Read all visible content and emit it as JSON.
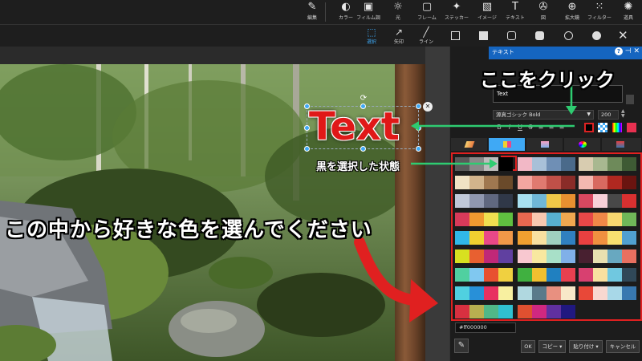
{
  "toolbar": {
    "items": [
      {
        "label": "編集",
        "icon": "edit-icon",
        "glyph": "✎"
      },
      {
        "label": "カラー",
        "icon": "color-icon",
        "glyph": "◐"
      },
      {
        "label": "フィルム調",
        "icon": "film-icon",
        "glyph": "▣"
      },
      {
        "label": "光",
        "icon": "light-icon",
        "glyph": "☼"
      },
      {
        "label": "フレーム",
        "icon": "frame-icon",
        "glyph": "▢"
      },
      {
        "label": "ステッカー",
        "icon": "sticker-icon",
        "glyph": "✦"
      },
      {
        "label": "イメージ",
        "icon": "image-icon",
        "glyph": "▧"
      },
      {
        "label": "テキスト",
        "icon": "text-icon",
        "glyph": "T"
      },
      {
        "label": "図",
        "icon": "shape-icon",
        "glyph": "✇"
      },
      {
        "label": "拡大鏡",
        "icon": "magnifier-icon",
        "glyph": "⊕"
      },
      {
        "label": "フィルター",
        "icon": "filter-icon",
        "glyph": "⁙"
      },
      {
        "label": "道具",
        "icon": "tools-icon",
        "glyph": "✺"
      }
    ]
  },
  "subtoolbar": {
    "select_label": "選択",
    "arrow_label": "矢印",
    "line_label": "ライン"
  },
  "panel": {
    "title": "テキスト",
    "help": "?",
    "pin": "⊣",
    "close": "✕",
    "text_value": "Text",
    "font": "源真ゴシック Bold",
    "font_arrow": "▼",
    "size": "200",
    "size_arrow": "▼",
    "format_buttons": [
      "B",
      "I",
      "U",
      "S",
      "≡",
      "≡",
      "≡"
    ],
    "hex_value": "#ff000000",
    "eyedropper": "✎",
    "ok_label": "OK",
    "copy_label": "コピー ▾",
    "paste_label": "貼り付け ▾",
    "cancel_label": "キャンセル"
  },
  "canvas": {
    "text_object": "Text",
    "rotate_glyph": "⟳",
    "close_glyph": "✕"
  },
  "annotations": {
    "click_here": "ここをクリック",
    "black_selected": "黒を選択した状態",
    "choose_color": "この中から好きな色を選んでください"
  },
  "colors": {
    "accent": "#3fa9f5",
    "annotation_red": "#e02020",
    "annotation_green": "#2ecc71"
  },
  "palettes": [
    [
      "#5a5a5a",
      "#8a8a8a",
      "#bdbdbd",
      "#000000"
    ],
    [
      "#f2b8c6",
      "#a8c0d8",
      "#6f8fb5",
      "#4a6a8a"
    ],
    [
      "#d8ccb0",
      "#a8b890",
      "#6e8a5a",
      "#3e5a34"
    ],
    [
      "#f0e2c4",
      "#d2b48c",
      "#a07850",
      "#6a4a2a"
    ],
    [
      "#f4a6a0",
      "#e07a70",
      "#c05048",
      "#8a2c28"
    ],
    [
      "#f4b8b0",
      "#d86a60",
      "#b02820",
      "#6a1410"
    ],
    [
      "#c0c8d8",
      "#9098b0",
      "#606880",
      "#303848"
    ],
    [
      "#a8e0f0",
      "#70b8d8",
      "#f0c848",
      "#e89030"
    ],
    [
      "#d84860",
      "#f8d0d8",
      "#484848",
      "#d83030"
    ],
    [
      "#d83a5a",
      "#f09a30",
      "#f0e050",
      "#60c040"
    ],
    [
      "#e86850",
      "#f8c8b0",
      "#58b0d0",
      "#f0a850"
    ],
    [
      "#e84848",
      "#f08848",
      "#f8d870",
      "#70b858"
    ],
    [
      "#30b8e8",
      "#f0d030",
      "#e84888",
      "#f09848"
    ],
    [
      "#f0a030",
      "#f8e0a0",
      "#a0d0c0",
      "#3080c0"
    ],
    [
      "#e84040",
      "#f09040",
      "#f8e070",
      "#50a0d0"
    ],
    [
      "#d8e020",
      "#e86030",
      "#c02878",
      "#6040a0"
    ],
    [
      "#f8c8d0",
      "#f8e8a0",
      "#a8e0c8",
      "#80b0e8"
    ],
    [
      "#482030",
      "#e8e0b0",
      "#68a8c0",
      "#e87060"
    ],
    [
      "#50d0a0",
      "#80c8f0",
      "#e85030",
      "#f0d040"
    ],
    [
      "#40b040",
      "#f0c030",
      "#2080c0",
      "#e84050"
    ],
    [
      "#d84070",
      "#f8e0a0",
      "#70c8e0",
      "#304858"
    ],
    [
      "#50d0e0",
      "#2890d8",
      "#e83060",
      "#f8f0a0"
    ],
    [
      "#b0d8e0",
      "#5a7a8a",
      "#e89080",
      "#f8e8c8"
    ],
    [
      "#e84838",
      "#f8d8d0",
      "#a8d8e8",
      "#3878b0"
    ],
    [
      "#d83040",
      "#b8b050",
      "#50b888",
      "#30c0d0"
    ],
    [
      "#e05030",
      "#d02880",
      "#6030a0",
      "#201880"
    ]
  ]
}
